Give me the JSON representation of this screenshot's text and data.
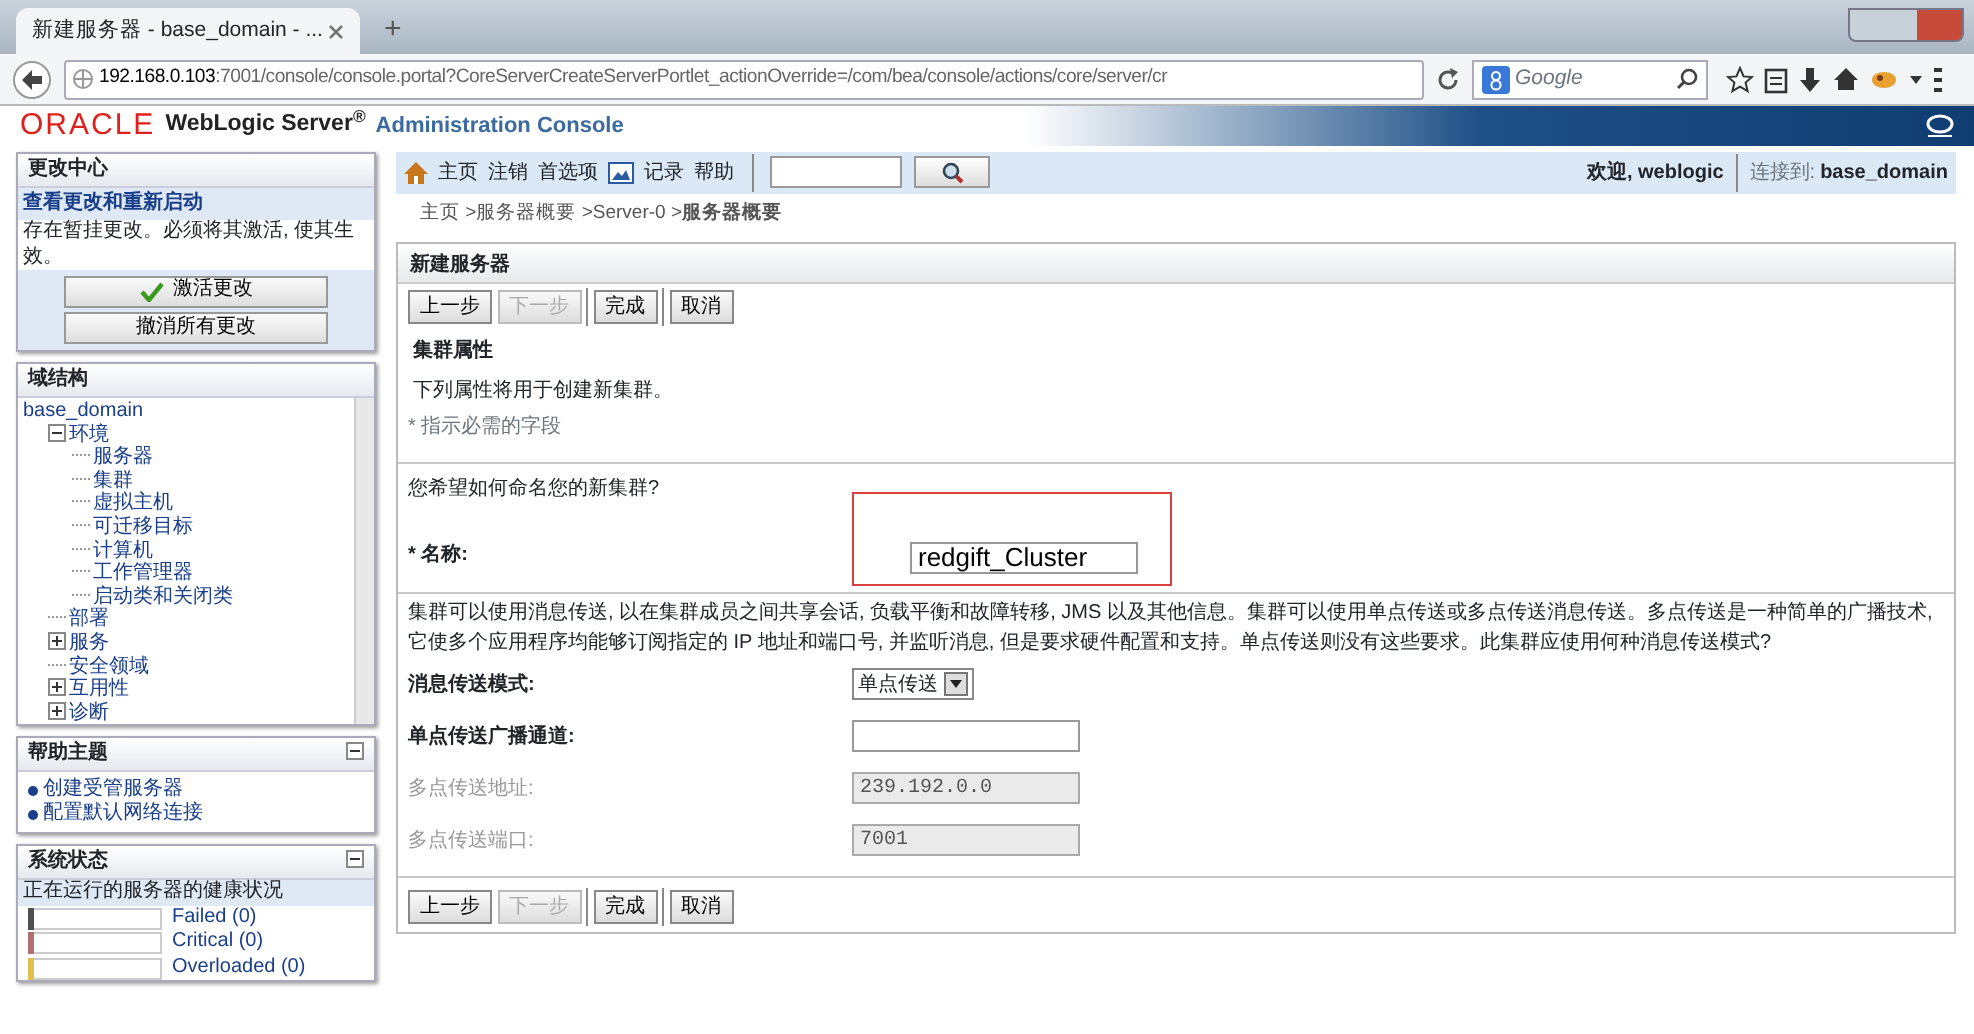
{
  "browser": {
    "tab_title": "新建服务器 - base_domain - ...",
    "new_tab": "+",
    "url_host": "192.168.0.103",
    "url_path": ":7001/console/console.portal?CoreServerCreateServerPortlet_actionOverride=/com/bea/console/actions/core/server/cr",
    "search_placeholder": "Google"
  },
  "header": {
    "brand": "ORACLE",
    "product": "WebLogic Server$^{®}$",
    "subtitle": "Administration Console"
  },
  "toolbar": {
    "links": [
      "主页",
      "注销",
      "首选项",
      "记录",
      "帮助"
    ],
    "welcome": "欢迎, weblogic",
    "connected_label": "连接到:",
    "connected_domain": "base_domain"
  },
  "breadcrumb": "主页 >服务器概要 >Server-0 >**服务器概要**",
  "change_center": {
    "title": "更改中心",
    "link": "查看更改和重新启动",
    "message": "存在暂挂更改。必须将其激活, 使其生效。",
    "buttons": [
      "激活更改",
      "撤消所有更改"
    ]
  },
  "domain_structure": {
    "title": "域结构",
    "tree": [
      {
        "label": "base_domain",
        "children": [
          {
            "label": "环境",
            "expanded": true,
            "children": [
              {
                "label": "服务器"
              },
              {
                "label": "集群"
              },
              {
                "label": "虚拟主机"
              },
              {
                "label": "可迁移目标"
              },
              {
                "label": "计算机"
              },
              {
                "label": "工作管理器"
              },
              {
                "label": "启动类和关闭类"
              }
            ]
          },
          {
            "label": "部署"
          },
          {
            "label": "服务",
            "expanded": false
          },
          {
            "label": "安全领域"
          },
          {
            "label": "互用性",
            "expanded": false
          },
          {
            "label": "诊断",
            "expanded": false
          }
        ]
      }
    ]
  },
  "help_topics": {
    "title": "帮助主题",
    "links": [
      "创建受管服务器",
      "配置默认网络连接"
    ]
  },
  "system_status": {
    "title": "系统状态",
    "subtitle": "正在运行的服务器的健康状况",
    "items": [
      {
        "label": "Failed (0)",
        "color": "#505050"
      },
      {
        "label": "Critical (0)",
        "color": "#b07070"
      },
      {
        "label": "Overloaded (0)",
        "color": "#e0c050"
      }
    ]
  },
  "main": {
    "title": "新建服务器",
    "buttons": [
      {
        "label": "上一步",
        "disabled": false
      },
      {
        "label": "下一步",
        "disabled": true
      },
      {
        "label": "完成",
        "disabled": false
      },
      {
        "label": "取消",
        "disabled": false
      }
    ],
    "bottom_buttons": [
      {
        "label": "上一步",
        "disabled": false
      },
      {
        "label": "下一步",
        "disabled": true
      },
      {
        "label": "完成",
        "disabled": false
      },
      {
        "label": "取消",
        "disabled": false
      }
    ],
    "section_title": "集群属性",
    "description": "下列属性将用于创建新集群。",
    "required_note": "* 指示必需的字段",
    "question": "您希望如何命名您的新集群?",
    "name_field": {
      "label": "* 名称:",
      "value": "redgift_Cluster",
      "highlighted": true
    },
    "info": "集群可以使用消息传送, 以在集群成员之间共享会话, 负载平衡和故障转移, JMS 以及其他信息。集群可以使用单点传送或多点传送消息传送。多点传送是一种简单的广播技术, 它使多个应用程序均能够订阅指定的 IP 地址和端口号, 并监听消息, 但是要求硬件配置和支持。单点传送则没有这些要求。此集群应使用何种消息传送模式?",
    "fields": [
      {
        "kind": "select",
        "label": "消息传送模式:",
        "value": "单点传送",
        "disabled": false
      },
      {
        "kind": "text",
        "label": "单点传送广播通道:",
        "disabled": false
      },
      {
        "kind": "text",
        "label": "多点传送地址:",
        "value": "239.192.0.0",
        "disabled": true
      },
      {
        "kind": "text",
        "label": "多点传送端口:",
        "value": "7001",
        "disabled": true
      }
    ]
  }
}
